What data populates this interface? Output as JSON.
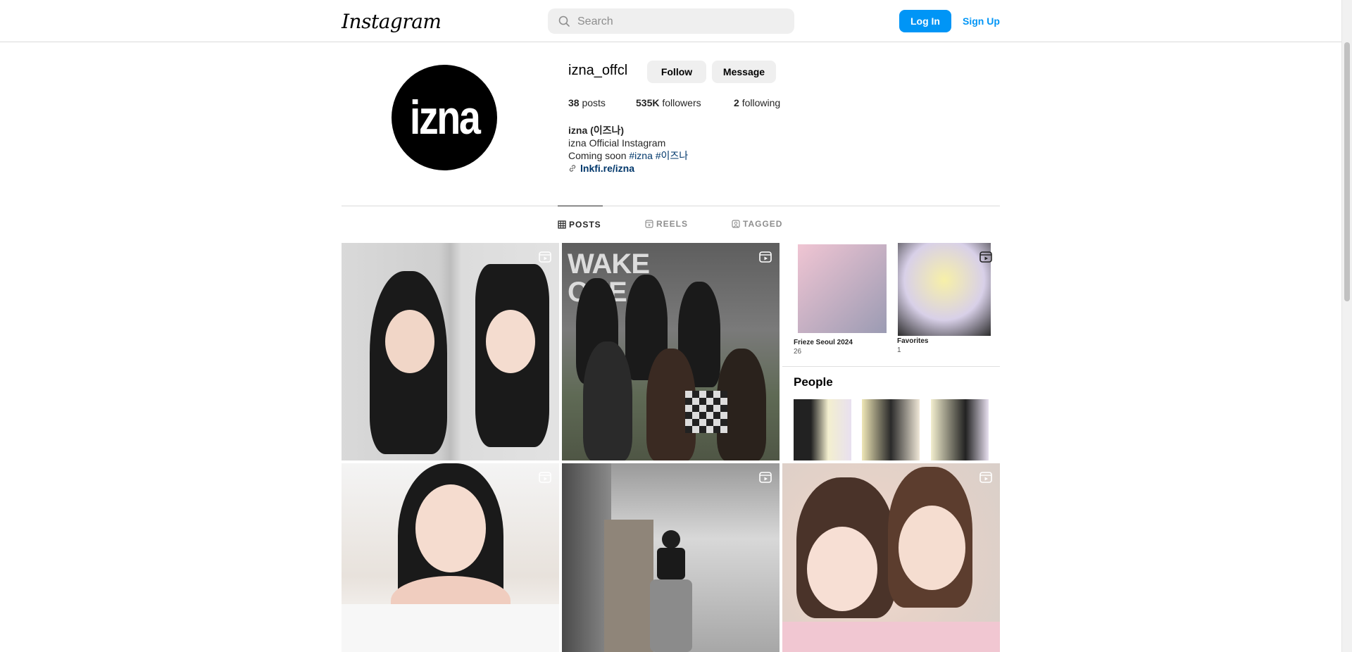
{
  "header": {
    "logo": "Instagram",
    "search_placeholder": "Search",
    "login_label": "Log In",
    "signup_label": "Sign Up"
  },
  "profile": {
    "avatar_text": "izna",
    "username": "izna_offcl",
    "follow_label": "Follow",
    "message_label": "Message",
    "stats": {
      "posts_count": "38",
      "posts_label": "posts",
      "followers_count": "535K",
      "followers_label": "followers",
      "following_count": "2",
      "following_label": "following"
    },
    "bio": {
      "name": "izna (이즈나)",
      "line1": "izna Official Instagram",
      "line2_text": "Coming soon",
      "hashtag1": "#izna",
      "hashtag2": "#이즈나",
      "link": "lnkfi.re/izna"
    }
  },
  "tabs": [
    {
      "label": "POSTS",
      "icon": "grid-icon",
      "active": true
    },
    {
      "label": "REELS",
      "icon": "reels-icon",
      "active": false
    },
    {
      "label": "TAGGED",
      "icon": "tagged-icon",
      "active": false
    }
  ],
  "posts": {
    "post3": {
      "album1_title": "Frieze Seoul 2024",
      "album1_count": "26",
      "album2_title": "Favorites",
      "album2_count": "1",
      "section_title": "People"
    },
    "post2": {
      "backdrop_text": "WAKE ONE"
    }
  }
}
